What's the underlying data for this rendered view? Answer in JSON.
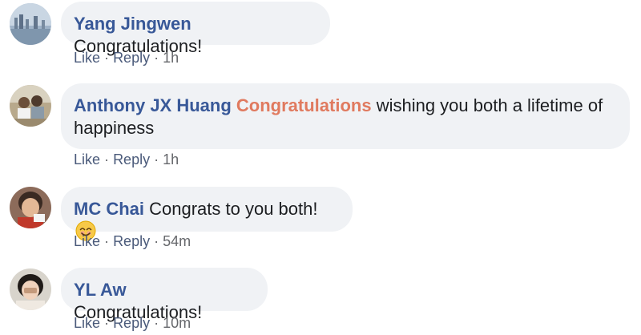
{
  "comments": [
    {
      "author": "Yang Jingwen",
      "text": "Congratulations!",
      "like_label": "Like",
      "reply_label": "Reply",
      "separator": "·",
      "time": "1h"
    },
    {
      "author": "Anthony JX Huang",
      "highlight": "Congratulations",
      "text": "wishing you both a lifetime of happiness",
      "like_label": "Like",
      "reply_label": "Reply",
      "separator": "·",
      "time": "1h"
    },
    {
      "author": "MC Chai",
      "text": "Congrats to you both!",
      "emoji": "smiling-face-emoji",
      "like_label": "Like",
      "reply_label": "Reply",
      "separator": "·",
      "time": "54m"
    },
    {
      "author": "YL Aw",
      "text": "Congratulations!",
      "like_label": "Like",
      "reply_label": "Reply",
      "separator": "·",
      "time": "10m"
    }
  ],
  "colors": {
    "author_link": "#385898",
    "highlight_text": "#e07a5f",
    "bubble_bg": "#f0f2f5",
    "meta_text": "#65676b"
  }
}
